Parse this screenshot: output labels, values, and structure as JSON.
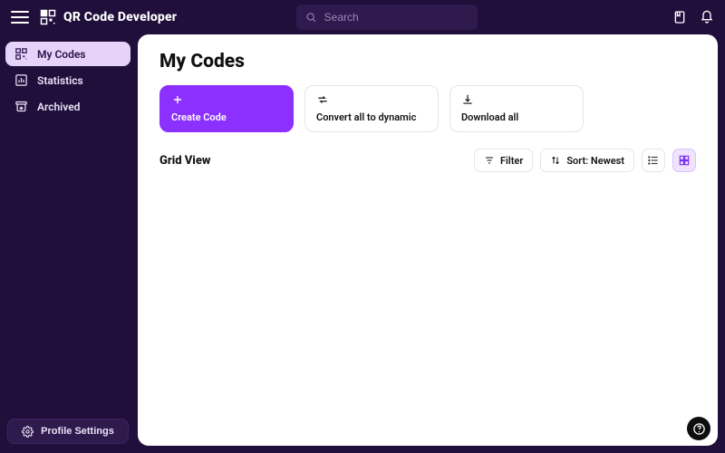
{
  "app": {
    "name": "QR Code Developer"
  },
  "search": {
    "placeholder": "Search"
  },
  "sidebar": {
    "items": [
      {
        "label": "My Codes",
        "active": true
      },
      {
        "label": "Statistics",
        "active": false
      },
      {
        "label": "Archived",
        "active": false
      }
    ],
    "profile_label": "Profile Settings"
  },
  "page": {
    "title": "My Codes",
    "actions": {
      "create_label": "Create Code",
      "convert_label": "Convert all to dynamic",
      "download_label": "Download all"
    },
    "view": {
      "title": "Grid View",
      "filter_label": "Filter",
      "sort_label": "Sort: Newest"
    }
  }
}
